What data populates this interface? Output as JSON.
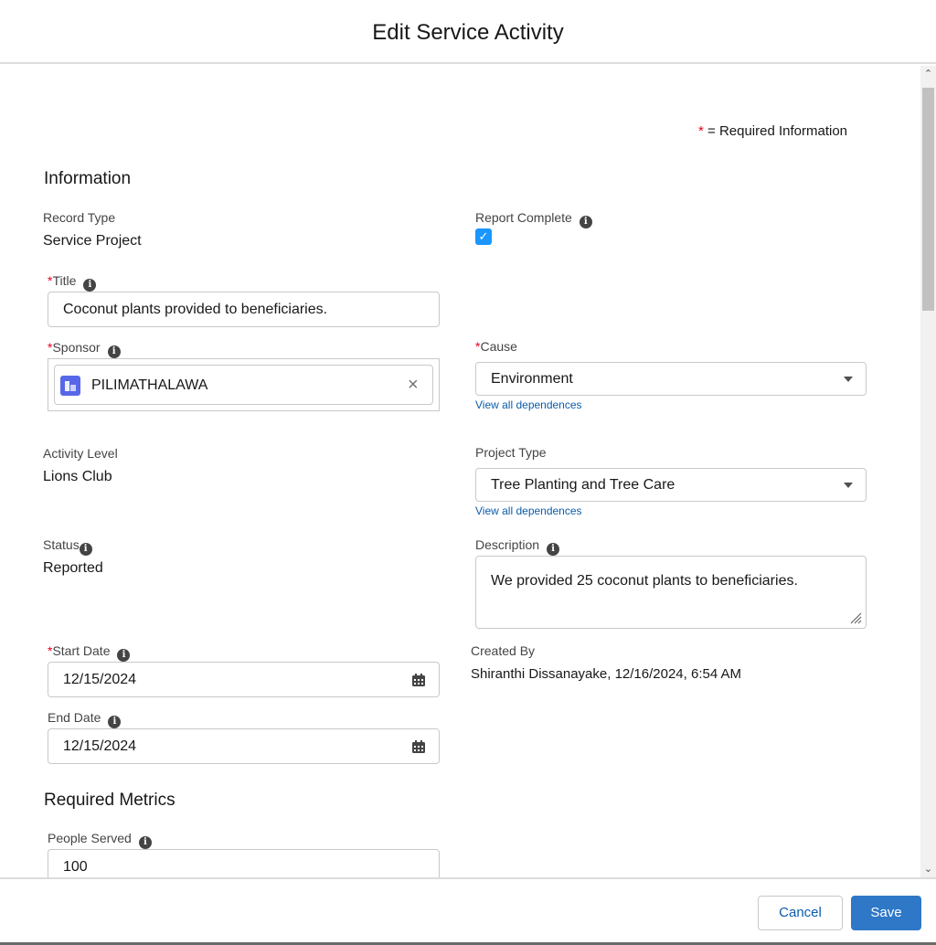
{
  "modal": {
    "title": "Edit Service Activity"
  },
  "required_info": {
    "star": "*",
    "text": "= Required Information"
  },
  "sections": {
    "information": "Information",
    "required_metrics": "Required Metrics"
  },
  "fields": {
    "record_type": {
      "label": "Record Type",
      "value": "Service Project"
    },
    "report_complete": {
      "label": "Report Complete",
      "checked": true
    },
    "title": {
      "label": "Title",
      "value": "Coconut plants provided to beneficiaries."
    },
    "sponsor": {
      "label": "Sponsor",
      "value": "PILIMATHALAWA"
    },
    "cause": {
      "label": "Cause",
      "value": "Environment",
      "link": "View all dependences"
    },
    "activity_level": {
      "label": "Activity Level",
      "value": "Lions Club"
    },
    "project_type": {
      "label": "Project Type",
      "value": "Tree Planting and Tree Care",
      "link": "View all dependences"
    },
    "status": {
      "label": "Status",
      "value": "Reported"
    },
    "description": {
      "label": "Description",
      "value": "We provided 25 coconut plants to beneficiaries."
    },
    "start_date": {
      "label": "Start Date",
      "value": "12/15/2024"
    },
    "created_by": {
      "label": "Created By",
      "value": "Shiranthi Dissanayake, 12/16/2024, 6:54 AM"
    },
    "end_date": {
      "label": "End Date",
      "value": "12/15/2024"
    },
    "people_served": {
      "label": "People Served",
      "value": "100"
    }
  },
  "footer": {
    "cancel_label": "Cancel",
    "save_label": "Save"
  },
  "colors": {
    "brand": "#2e78c7",
    "required": "#ea001e",
    "link": "#0b5cab",
    "checkbox": "#1b96ff",
    "sponsor_icon": "#5867e8"
  },
  "icons": [
    "info-icon",
    "check-icon",
    "account-icon",
    "clear-icon",
    "chevron-down-icon",
    "calendar-icon",
    "resize-icon"
  ]
}
